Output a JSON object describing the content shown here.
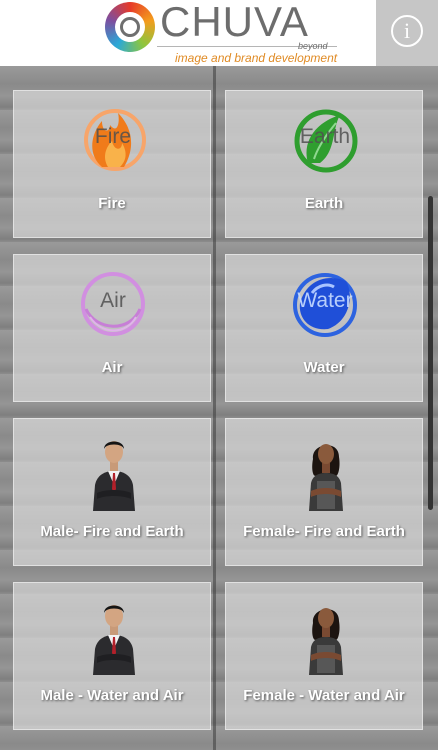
{
  "header": {
    "brand_name": "CHUVA",
    "brand_beyond": "beyond",
    "tagline": "image and brand development",
    "info_label": "i"
  },
  "tiles": [
    {
      "label": "Fire",
      "icon": "fire-icon",
      "icon_text": "Fire",
      "color": "#f07b1a"
    },
    {
      "label": "Earth",
      "icon": "earth-leaf-icon",
      "icon_text": "Earth",
      "color": "#2f9e2f"
    },
    {
      "label": "Air",
      "icon": "air-icon",
      "icon_text": "Air",
      "color": "#c77fd6"
    },
    {
      "label": "Water",
      "icon": "water-drop-icon",
      "icon_text": "Water",
      "color": "#1f4fd8"
    },
    {
      "label": "Male- Fire and Earth",
      "icon": "male-avatar"
    },
    {
      "label": "Female- Fire and Earth",
      "icon": "female-avatar"
    },
    {
      "label": "Male - Water and Air",
      "icon": "male-avatar"
    },
    {
      "label": "Female - Water and Air",
      "icon": "female-avatar"
    }
  ]
}
